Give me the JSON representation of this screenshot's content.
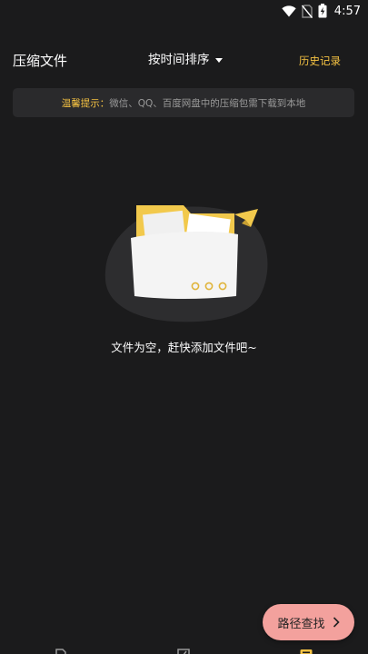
{
  "status_bar": {
    "time": "4:57",
    "icons": [
      "wifi-icon",
      "no-sim-icon",
      "battery-charging-icon"
    ]
  },
  "header": {
    "title": "压缩文件",
    "sort_label": "按时间排序",
    "history_label": "历史记录"
  },
  "tip": {
    "prefix": "温馨提示：",
    "text": "微信、QQ、百度网盘中的压缩包需下载到本地"
  },
  "empty_state": {
    "illustration": "empty-folder-icon",
    "message": "文件为空，赶快添加文件吧~"
  },
  "fab": {
    "label": "路径查找",
    "icon": "chevron-right-icon"
  },
  "bottom_nav": {
    "items": [
      "file-tab-icon",
      "edit-tab-icon",
      "archive-tab-icon"
    ],
    "active_index": 2
  },
  "colors": {
    "background": "#1b1b1c",
    "accent": "#f5c242",
    "banner_bg": "#2a2a2c",
    "fab_bg": "#f3a19d",
    "folder_yellow": "#f2c94c"
  }
}
